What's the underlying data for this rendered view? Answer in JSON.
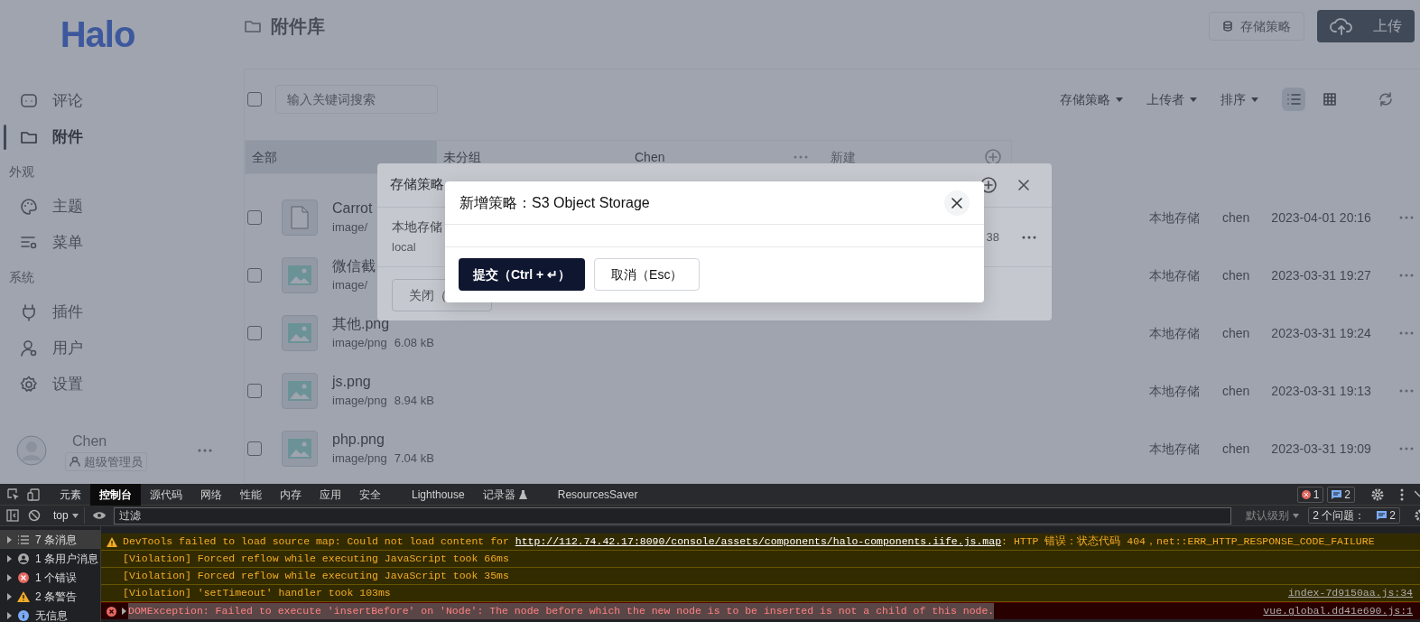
{
  "sidebar": {
    "logo": "Halo",
    "nav": [
      {
        "kind": "item",
        "label": "评论",
        "selected": false
      },
      {
        "kind": "item",
        "label": "附件",
        "selected": true
      },
      {
        "kind": "heading",
        "label": "外观"
      },
      {
        "kind": "item",
        "label": "主题",
        "selected": false
      },
      {
        "kind": "item",
        "label": "菜单",
        "selected": false
      },
      {
        "kind": "heading",
        "label": "系统"
      },
      {
        "kind": "item",
        "label": "插件",
        "selected": false
      },
      {
        "kind": "item",
        "label": "用户",
        "selected": false
      },
      {
        "kind": "item",
        "label": "设置",
        "selected": false
      }
    ],
    "user": {
      "name": "Chen",
      "role": "超级管理员"
    }
  },
  "header": {
    "title": "附件库",
    "policy_button": "存储策略",
    "upload_button": "上传"
  },
  "toolbar": {
    "select_all": {
      "checked": false
    },
    "search_placeholder": "输入关键词搜索",
    "filters": [
      "存储策略",
      "上传者",
      "排序"
    ],
    "views": [
      {
        "kind": "list",
        "selected": true
      },
      {
        "kind": "grid",
        "selected": false
      }
    ]
  },
  "groups": [
    {
      "label": "全部",
      "selected": true
    },
    {
      "label": "未分组",
      "selected": false
    },
    {
      "label": "Chen",
      "selected": false
    }
  ],
  "new_group": "新建",
  "files": [
    {
      "kind": "file",
      "checked": false,
      "name": "Carrot",
      "type": "image/",
      "policy": "本地存储",
      "owner": "chen",
      "time": "2023-04-01 20:16"
    },
    {
      "kind": "image",
      "checked": false,
      "name": "微信截",
      "type": "image/",
      "policy": "本地存储",
      "owner": "chen",
      "time": "2023-03-31 19:27"
    },
    {
      "kind": "image",
      "checked": false,
      "name": "其他.png",
      "type": "image/png",
      "size": "6.08 kB",
      "policy": "本地存储",
      "owner": "chen",
      "time": "2023-03-31 19:24"
    },
    {
      "kind": "image",
      "checked": false,
      "name": "js.png",
      "type": "image/png",
      "size": "8.94 kB",
      "policy": "本地存储",
      "owner": "chen",
      "time": "2023-03-31 19:13"
    },
    {
      "kind": "image",
      "checked": false,
      "name": "php.png",
      "type": "image/png",
      "size": "7.04 kB",
      "policy": "本地存储",
      "owner": "chen",
      "time": "2023-03-31 19:09"
    }
  ],
  "policy_modal": {
    "title": "存储策略",
    "policy": {
      "name": "本地存储",
      "id": "local",
      "time": "38"
    },
    "close_button": "关闭（"
  },
  "new_policy_modal": {
    "title": "新增策略：S3 Object Storage",
    "submit_button": "提交（Ctrl + ↵）",
    "cancel_button": "取消（Esc）"
  },
  "devtools": {
    "tabs": [
      {
        "kind": "plain",
        "label": "元素",
        "selected": false
      },
      {
        "kind": "plain",
        "label": "控制台",
        "selected": true
      },
      {
        "kind": "plain",
        "label": "源代码",
        "selected": false
      },
      {
        "kind": "plain",
        "label": "网络",
        "selected": false
      },
      {
        "kind": "plain",
        "label": "性能",
        "selected": false
      },
      {
        "kind": "plain",
        "label": "内存",
        "selected": false
      },
      {
        "kind": "plain",
        "label": "应用",
        "selected": false
      },
      {
        "kind": "plain",
        "label": "安全",
        "selected": false
      },
      {
        "kind": "plain",
        "label": "Lighthouse",
        "selected": false
      },
      {
        "kind": "beta",
        "label": "记录器",
        "selected": false
      },
      {
        "kind": "plain",
        "label": "ResourcesSaver",
        "selected": false
      }
    ],
    "error_count": "1",
    "message_count": "2",
    "context": "top",
    "filter_placeholder": "过滤",
    "level": "默认级别",
    "issues_label": "2 个问题：",
    "issues_count": "2",
    "sidebar": [
      {
        "label": "7 条消息",
        "selected": true
      },
      {
        "label": "1 条用户消息",
        "selected": false
      },
      {
        "label": "1 个错误",
        "selected": false
      },
      {
        "label": "2 条警告",
        "selected": false
      },
      {
        "label": "无信息",
        "selected": false
      }
    ],
    "messages": [
      {
        "kind": "warning",
        "text": "DevTools failed to load source map: Could not load content for ",
        "link": "http://112.74.42.17:8090/console/assets/components/halo-components.iife.js.map",
        "tail": ": HTTP 错误：状态代码 404，net::ERR_HTTP_RESPONSE_CODE_FAILURE"
      },
      {
        "kind": "violation",
        "text": "[Violation] Forced reflow while executing JavaScript took 66ms"
      },
      {
        "kind": "violation",
        "text": "[Violation] Forced reflow while executing JavaScript took 35ms"
      },
      {
        "kind": "violation",
        "text": "[Violation] 'setTimeout' handler took 103ms",
        "source": "index-7d9150aa.js:34"
      },
      {
        "kind": "error",
        "text": "DOMException: Failed to execute 'insertBefore' on 'Node': The node before which the new node is to be inserted is not a child of this node.",
        "source": "vue.global.dd41e690.js:1",
        "highlighted": true
      }
    ]
  }
}
